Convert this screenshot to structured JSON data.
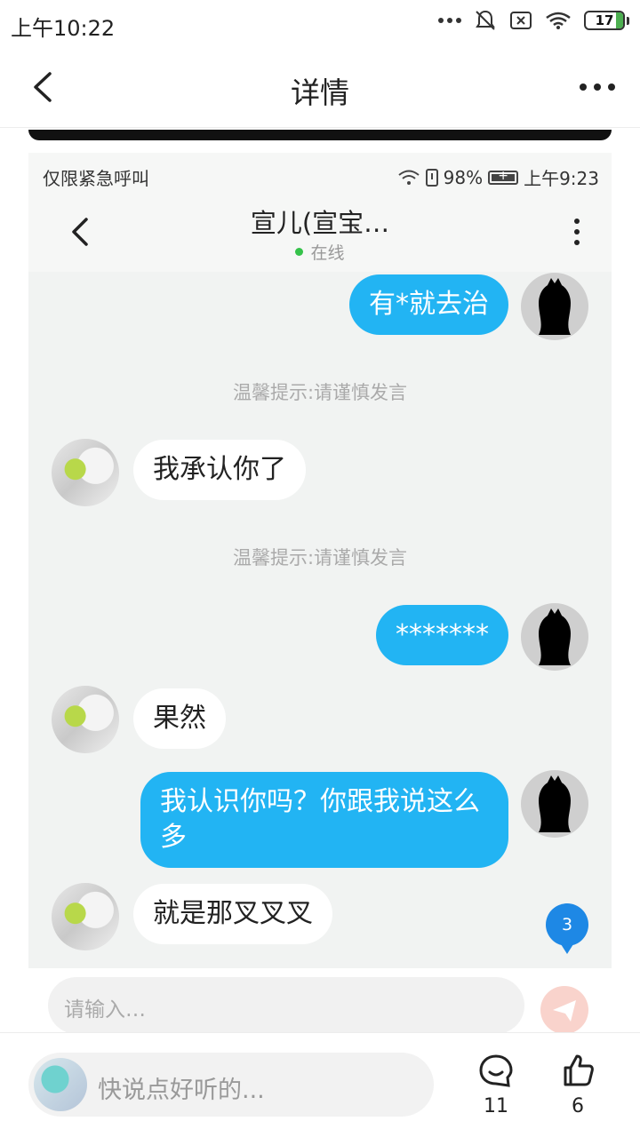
{
  "status_bar": {
    "time": "上午10:22",
    "battery": "17"
  },
  "header": {
    "title": "详情"
  },
  "embedded": {
    "status_left": "仅限紧急呼叫",
    "battery": "98%",
    "time": "上午9:23",
    "chat_title": "宣儿(宣宝…",
    "online_label": "在线",
    "messages": [
      {
        "side": "mine",
        "text": "有*就去治"
      },
      {
        "side": "tip",
        "text": "温馨提示:请谨慎发言"
      },
      {
        "side": "theirs",
        "text": "我承认你了"
      },
      {
        "side": "tip",
        "text": "温馨提示:请谨慎发言"
      },
      {
        "side": "mine",
        "text": "*******"
      },
      {
        "side": "theirs",
        "text": "果然"
      },
      {
        "side": "mine",
        "text": "我认识你吗？你跟我说这么多"
      },
      {
        "side": "theirs",
        "text": "就是那叉叉叉"
      }
    ],
    "unread_badge": "3",
    "input_placeholder": "请输入…"
  },
  "bottom_bar": {
    "comment_placeholder": "快说点好听的...",
    "comment_count": "11",
    "like_count": "6"
  }
}
